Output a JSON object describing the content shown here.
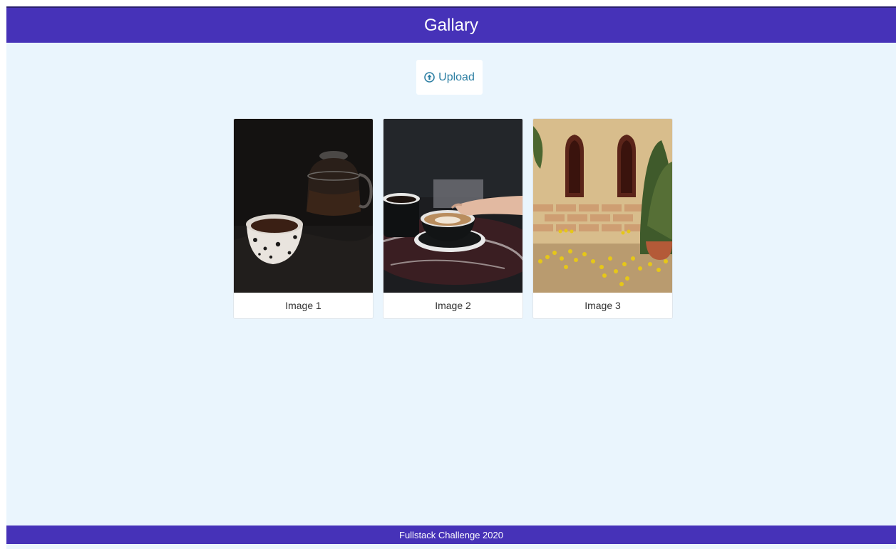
{
  "header": {
    "title": "Gallary"
  },
  "upload": {
    "label": "Upload",
    "icon": "upload-circle-icon"
  },
  "gallery": {
    "items": [
      {
        "caption": "Image 1"
      },
      {
        "caption": "Image 2"
      },
      {
        "caption": "Image 3"
      }
    ]
  },
  "footer": {
    "text": "Fullstack Challenge 2020"
  },
  "colors": {
    "brand": "#4632b8",
    "page_background": "#eaf5fd",
    "accent_text": "#2d7fa3"
  }
}
